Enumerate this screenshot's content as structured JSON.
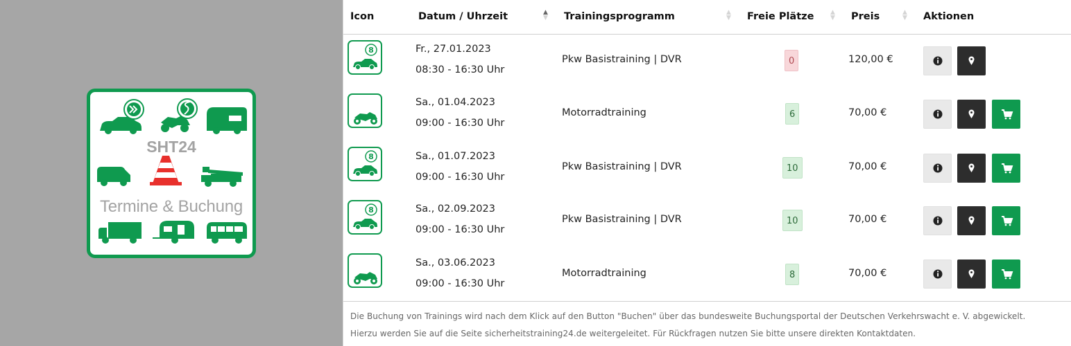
{
  "logo": {
    "title": "SHT24",
    "subtitle": "Termine & Buchung",
    "brand_color": "#0f9a4f",
    "cone_color": "#e8302c",
    "icons": [
      "car-icon",
      "motorcycle-icon",
      "camper-icon",
      "van-icon",
      "traffic-cone-icon",
      "crane-truck-icon",
      "truck-icon",
      "caravan-icon",
      "bus-icon"
    ]
  },
  "table": {
    "columns": {
      "icon": "Icon",
      "date": "Datum / Uhrzeit",
      "program": "Trainingsprogramm",
      "seats": "Freie Plätze",
      "price": "Preis",
      "actions": "Aktionen"
    },
    "rows": [
      {
        "icon": "car-icon",
        "date": "Fr., 27.01.2023",
        "time": "08:30 - 16:30 Uhr",
        "program": "Pkw Basistraining | DVR",
        "seats": "0",
        "seats_status": "full",
        "price": "120,00 €",
        "buttons": [
          "info",
          "location"
        ]
      },
      {
        "icon": "motorcycle-icon",
        "date": "Sa., 01.04.2023",
        "time": "09:00 - 16:30 Uhr",
        "program": "Motorradtraining",
        "seats": "6",
        "seats_status": "available",
        "price": "70,00 €",
        "buttons": [
          "info",
          "location",
          "cart"
        ]
      },
      {
        "icon": "car-icon",
        "date": "Sa., 01.07.2023",
        "time": "09:00 - 16:30 Uhr",
        "program": "Pkw Basistraining | DVR",
        "seats": "10",
        "seats_status": "available",
        "price": "70,00 €",
        "buttons": [
          "info",
          "location",
          "cart"
        ]
      },
      {
        "icon": "car-icon",
        "date": "Sa., 02.09.2023",
        "time": "09:00 - 16:30 Uhr",
        "program": "Pkw Basistraining | DVR",
        "seats": "10",
        "seats_status": "available",
        "price": "70,00 €",
        "buttons": [
          "info",
          "location",
          "cart"
        ]
      },
      {
        "icon": "motorcycle-icon",
        "date": "Sa., 03.06.2023",
        "time": "09:00 - 16:30 Uhr",
        "program": "Motorradtraining",
        "seats": "8",
        "seats_status": "available",
        "price": "70,00 €",
        "buttons": [
          "info",
          "location",
          "cart"
        ]
      }
    ]
  },
  "footnote": "Die Buchung von Trainings wird nach dem Klick auf den Button \"Buchen\" über das bundesweite Buchungsportal der Deutschen Verkehrswacht e. V. abgewickelt. Hierzu werden Sie auf die Seite sicherheitstraining24.de weitergeleitet. Für Rückfragen nutzen Sie bitte unsere direkten Kontaktdaten.",
  "colors": {
    "accent": "#0f9a4f",
    "dark_button": "#2d2d2d",
    "light_button": "#e9e9e9",
    "badge_ok": "#d8f0dc",
    "badge_full": "#f8d7da"
  }
}
